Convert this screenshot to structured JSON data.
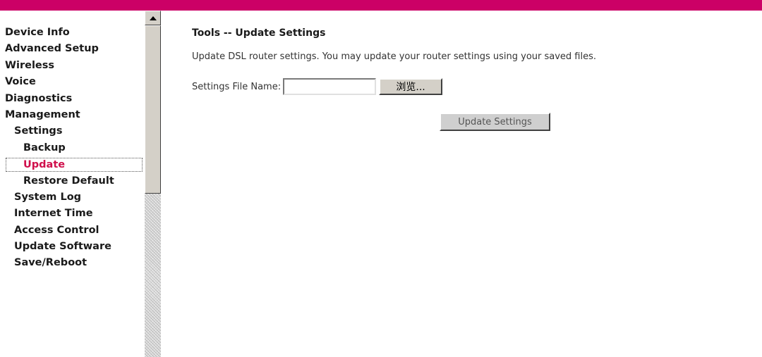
{
  "colors": {
    "top_bar": "#cc0066",
    "active_nav": "#d0104c"
  },
  "sidebar": {
    "items": [
      {
        "label": "Device Info",
        "level": 1
      },
      {
        "label": "Advanced Setup",
        "level": 1
      },
      {
        "label": "Wireless",
        "level": 1
      },
      {
        "label": "Voice",
        "level": 1
      },
      {
        "label": "Diagnostics",
        "level": 1
      },
      {
        "label": "Management",
        "level": 1
      },
      {
        "label": "Settings",
        "level": 2
      },
      {
        "label": "Backup",
        "level": 3
      },
      {
        "label": "Update",
        "level": 3,
        "active": true
      },
      {
        "label": "Restore Default",
        "level": 3
      },
      {
        "label": "System Log",
        "level": 2
      },
      {
        "label": "Internet Time",
        "level": 2
      },
      {
        "label": "Access Control",
        "level": 2
      },
      {
        "label": "Update Software",
        "level": 2
      },
      {
        "label": "Save/Reboot",
        "level": 2
      }
    ]
  },
  "main": {
    "title": "Tools -- Update Settings",
    "description": "Update DSL router settings. You may update your router settings using your saved files.",
    "file_label": "Settings File Name:",
    "file_value": "",
    "browse_label": "浏览...",
    "update_label": "Update Settings"
  }
}
